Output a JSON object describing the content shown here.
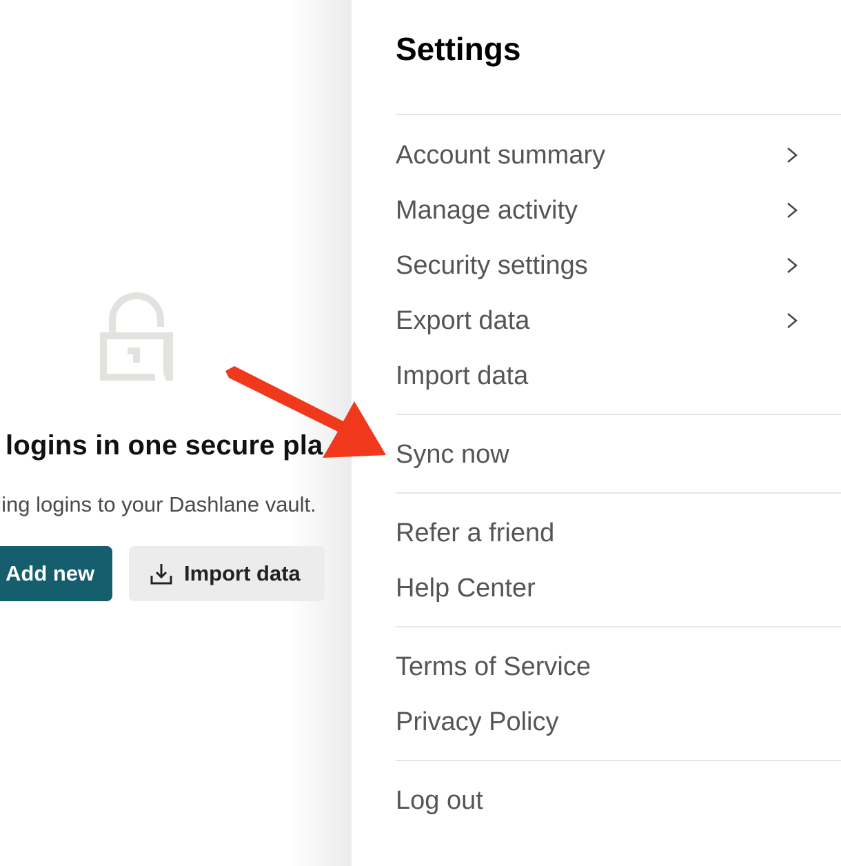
{
  "vault": {
    "empty_title": "logins in one secure pla",
    "empty_subtitle": "lding logins to your Dashlane vault.",
    "add_new_label": "Add new",
    "import_data_label": "Import data",
    "icons": [
      "lock-icon",
      "import-icon"
    ]
  },
  "settings": {
    "title": "Settings",
    "groups": [
      {
        "items": [
          {
            "label": "Account summary",
            "has_chevron": true
          },
          {
            "label": "Manage activity",
            "has_chevron": true
          },
          {
            "label": "Security settings",
            "has_chevron": true
          },
          {
            "label": "Export data",
            "has_chevron": true
          },
          {
            "label": "Import data",
            "has_chevron": false
          }
        ]
      },
      {
        "items": [
          {
            "label": "Sync now",
            "has_chevron": false
          }
        ]
      },
      {
        "items": [
          {
            "label": "Refer a friend",
            "has_chevron": false
          },
          {
            "label": "Help Center",
            "has_chevron": false
          }
        ]
      },
      {
        "items": [
          {
            "label": "Terms of Service",
            "has_chevron": false
          },
          {
            "label": "Privacy Policy",
            "has_chevron": false
          }
        ]
      },
      {
        "items": [
          {
            "label": "Log out",
            "has_chevron": false
          }
        ]
      }
    ]
  },
  "colors": {
    "primary_button": "#155e6e",
    "secondary_button": "#ececec",
    "annotation_arrow": "#f0381c"
  }
}
